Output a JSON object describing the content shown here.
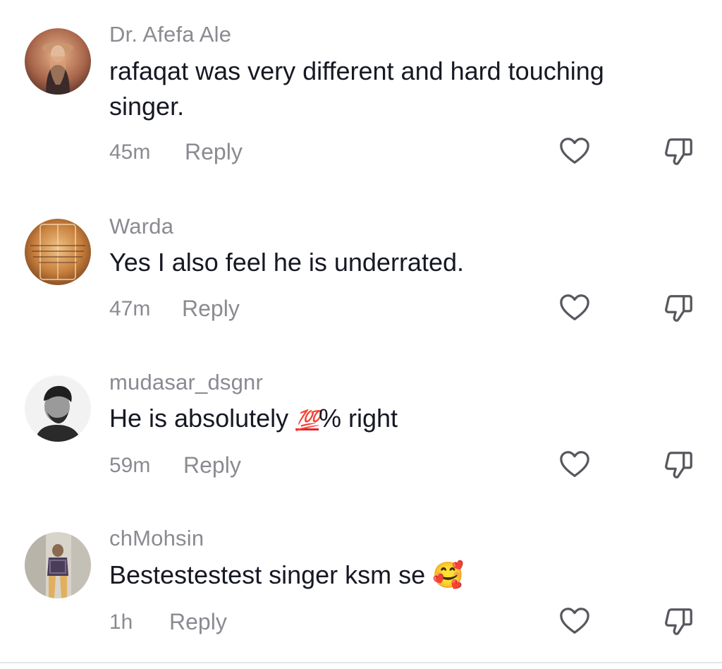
{
  "comments": [
    {
      "username": "Dr. Afefa Ale",
      "text": "rafaqat was very different and hard touching singer.",
      "time": "45m",
      "reply_label": "Reply",
      "like_icon": "heart-outline-icon",
      "dislike_icon": "thumbs-down-icon"
    },
    {
      "username": "Warda",
      "text": "Yes I also feel he is underrated.",
      "time": "47m",
      "reply_label": "Reply",
      "like_icon": "heart-outline-icon",
      "dislike_icon": "thumbs-down-icon"
    },
    {
      "username": "mudasar_dsgnr",
      "text_before": "He is absolutely ",
      "emoji": "💯",
      "text_after": "% right",
      "time": "59m",
      "reply_label": "Reply",
      "like_icon": "heart-outline-icon",
      "dislike_icon": "thumbs-down-icon"
    },
    {
      "username": "chMohsin",
      "text": "Bestestestest singer ksm se",
      "emoji": "🥰",
      "time": "1h",
      "reply_label": "Reply",
      "like_icon": "heart-outline-icon",
      "dislike_icon": "thumbs-down-icon"
    }
  ],
  "colors": {
    "primary_text": "#161823",
    "secondary_text": "#8a8b91",
    "icon": "#57585e",
    "background": "#ffffff"
  }
}
